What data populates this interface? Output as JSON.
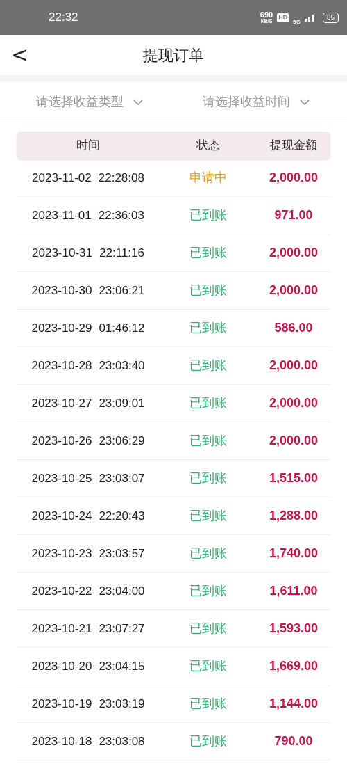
{
  "status_bar": {
    "time": "22:32",
    "speed": "690",
    "speed_unit": "KB/S",
    "hd": "HD",
    "network": "5G",
    "battery": "85"
  },
  "header": {
    "back": "<",
    "title": "提现订单"
  },
  "filters": [
    {
      "placeholder": "请选择收益类型"
    },
    {
      "placeholder": "请选择收益时间"
    }
  ],
  "table": {
    "columns": [
      "时间",
      "状态",
      "提现金额"
    ],
    "rows": [
      {
        "date": "2023-11-02",
        "time": "22:28:08",
        "status": "申请中",
        "kind": "pending",
        "amount": "2,000.00"
      },
      {
        "date": "2023-11-01",
        "time": "22:36:03",
        "status": "已到账",
        "kind": "done",
        "amount": "971.00"
      },
      {
        "date": "2023-10-31",
        "time": "22:11:16",
        "status": "已到账",
        "kind": "done",
        "amount": "2,000.00"
      },
      {
        "date": "2023-10-30",
        "time": "23:06:21",
        "status": "已到账",
        "kind": "done",
        "amount": "2,000.00"
      },
      {
        "date": "2023-10-29",
        "time": "01:46:12",
        "status": "已到账",
        "kind": "done",
        "amount": "586.00"
      },
      {
        "date": "2023-10-28",
        "time": "23:03:40",
        "status": "已到账",
        "kind": "done",
        "amount": "2,000.00"
      },
      {
        "date": "2023-10-27",
        "time": "23:09:01",
        "status": "已到账",
        "kind": "done",
        "amount": "2,000.00"
      },
      {
        "date": "2023-10-26",
        "time": "23:06:29",
        "status": "已到账",
        "kind": "done",
        "amount": "2,000.00"
      },
      {
        "date": "2023-10-25",
        "time": "23:03:07",
        "status": "已到账",
        "kind": "done",
        "amount": "1,515.00"
      },
      {
        "date": "2023-10-24",
        "time": "22:20:43",
        "status": "已到账",
        "kind": "done",
        "amount": "1,288.00"
      },
      {
        "date": "2023-10-23",
        "time": "23:03:57",
        "status": "已到账",
        "kind": "done",
        "amount": "1,740.00"
      },
      {
        "date": "2023-10-22",
        "time": "23:04:00",
        "status": "已到账",
        "kind": "done",
        "amount": "1,611.00"
      },
      {
        "date": "2023-10-21",
        "time": "23:07:27",
        "status": "已到账",
        "kind": "done",
        "amount": "1,593.00"
      },
      {
        "date": "2023-10-20",
        "time": "23:04:15",
        "status": "已到账",
        "kind": "done",
        "amount": "1,669.00"
      },
      {
        "date": "2023-10-19",
        "time": "23:03:19",
        "status": "已到账",
        "kind": "done",
        "amount": "1,144.00"
      },
      {
        "date": "2023-10-18",
        "time": "23:03:08",
        "status": "已到账",
        "kind": "done",
        "amount": "790.00"
      }
    ]
  }
}
